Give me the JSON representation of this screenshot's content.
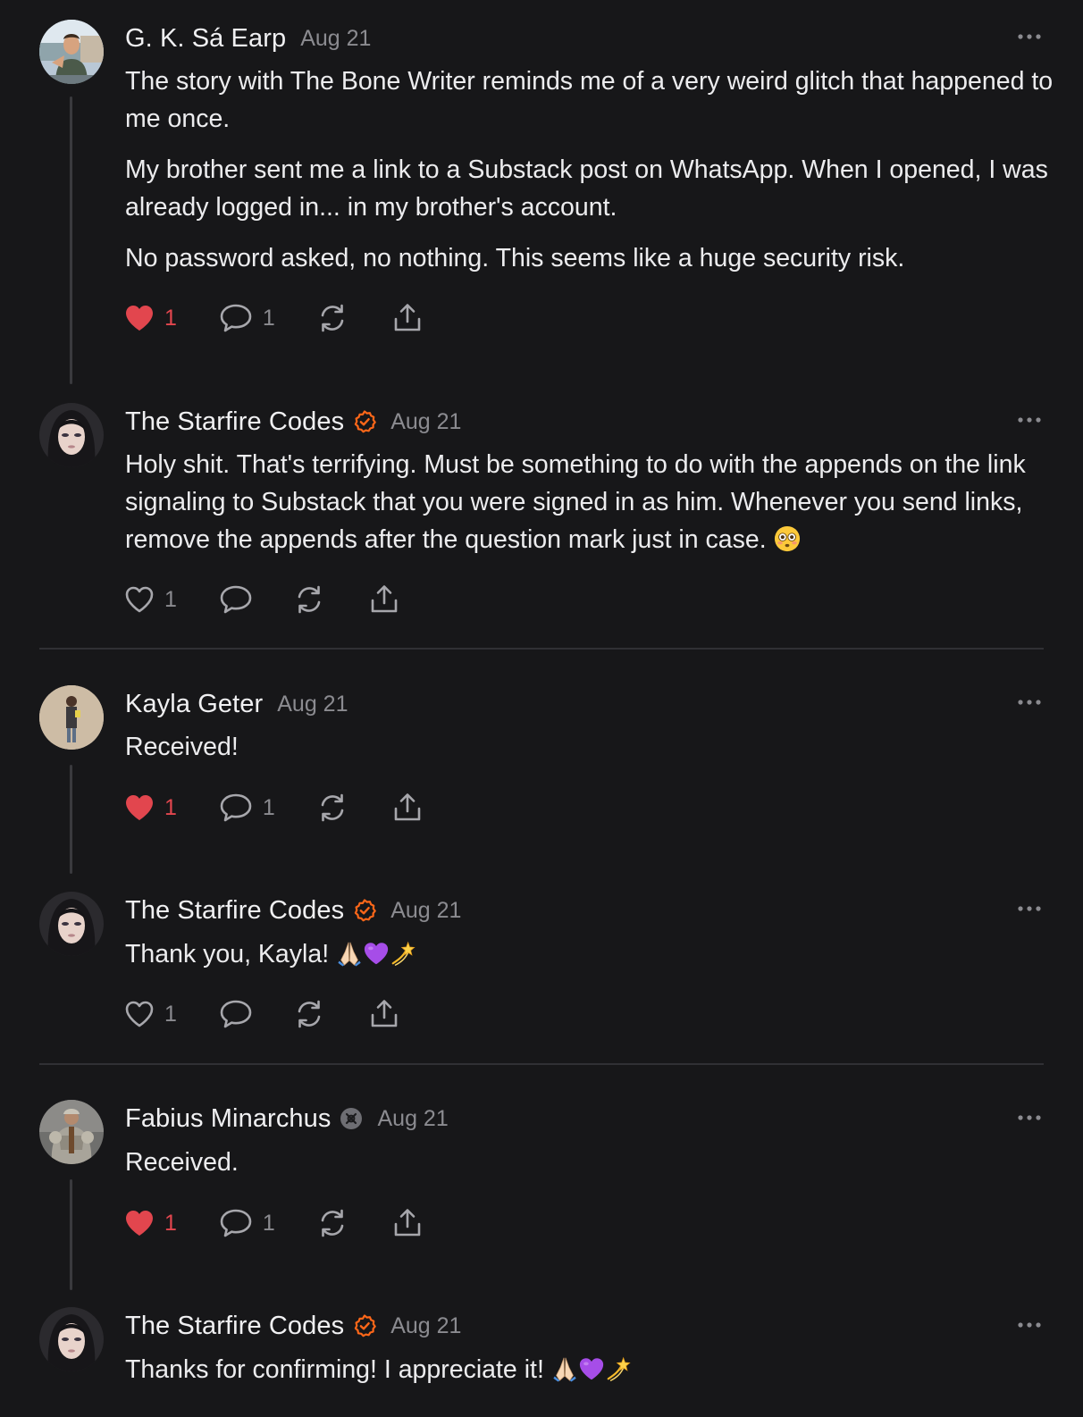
{
  "comments": [
    {
      "author": "G. K. Sá Earp",
      "date": "Aug 21",
      "verified": false,
      "avatar": "avatar-photo-man-outdoors",
      "paragraphs": [
        "The story with The Bone Writer reminds me of a very weird glitch that happened to me once.",
        "My brother sent me a link to a Substack post on WhatsApp. When I opened, I was already logged in... in my brother's account.",
        "No password asked, no nothing. This seems like a huge security risk."
      ],
      "likes": "1",
      "liked": true,
      "replies": "1"
    },
    {
      "author": "The Starfire Codes",
      "date": "Aug 21",
      "verified": true,
      "avatar": "avatar-photo-woman",
      "paragraphs": [
        "Holy shit. That's terrifying. Must be something to do with the appends on the link signaling to Substack that you were signed in as him. Whenever you send links, remove the appends after the question mark just in case."
      ],
      "emoji": [
        "flushed-face-emoji"
      ],
      "likes": "1",
      "liked": false,
      "replies": ""
    },
    {
      "author": "Kayla Geter",
      "date": "Aug 21",
      "verified": false,
      "avatar": "avatar-photo-person-standing",
      "paragraphs": [
        "Received!"
      ],
      "likes": "1",
      "liked": true,
      "replies": "1"
    },
    {
      "author": "The Starfire Codes",
      "date": "Aug 21",
      "verified": true,
      "avatar": "avatar-photo-woman",
      "paragraphs": [
        "Thank you, Kayla! "
      ],
      "emoji": [
        "folded-hands-emoji",
        "purple-heart-emoji",
        "dizzy-star-emoji"
      ],
      "likes": "1",
      "liked": false,
      "replies": ""
    },
    {
      "author": "Fabius Minarchus",
      "date": "Aug 21",
      "verified": false,
      "avatar": "avatar-photo-armored-knight",
      "paragraphs": [
        "Received."
      ],
      "likes": "1",
      "liked": true,
      "replies": "1"
    },
    {
      "author": "The Starfire Codes",
      "date": "Aug 21",
      "verified": true,
      "avatar": "avatar-photo-woman",
      "paragraphs": [
        "Thanks for confirming! I appreciate it! "
      ],
      "emoji": [
        "folded-hands-emoji",
        "purple-heart-emoji",
        "dizzy-star-emoji"
      ]
    }
  ],
  "colors": {
    "background": "#171719",
    "text": "#ececee",
    "muted": "#8b8b90",
    "liked": "#e2464e",
    "verified": "#ff6719",
    "divider": "#303034"
  },
  "icons": [
    "heart-icon",
    "comment-icon",
    "restack-icon",
    "share-icon",
    "more-icon",
    "verified-badge-icon",
    "subscriber-badge-icon"
  ]
}
